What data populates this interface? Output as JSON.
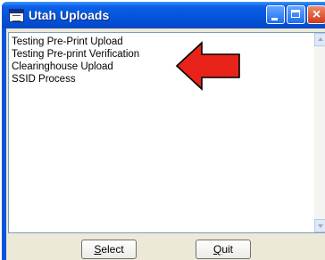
{
  "window": {
    "title": "Utah Uploads",
    "close_glyph": "×"
  },
  "list": {
    "items": [
      "Testing Pre-Print Upload",
      "Testing Pre-print Verification",
      "Clearinghouse Upload",
      "SSID Process"
    ]
  },
  "buttons": {
    "select": {
      "mnemonic": "S",
      "rest": "elect"
    },
    "quit": {
      "mnemonic": "Q",
      "rest": "uit"
    }
  },
  "annotation": {
    "color": "#e8231a",
    "icon": "red-arrow-pointing-left"
  },
  "colors": {
    "titlebar": "#0553da",
    "dialog_face": "#ece9d8"
  }
}
